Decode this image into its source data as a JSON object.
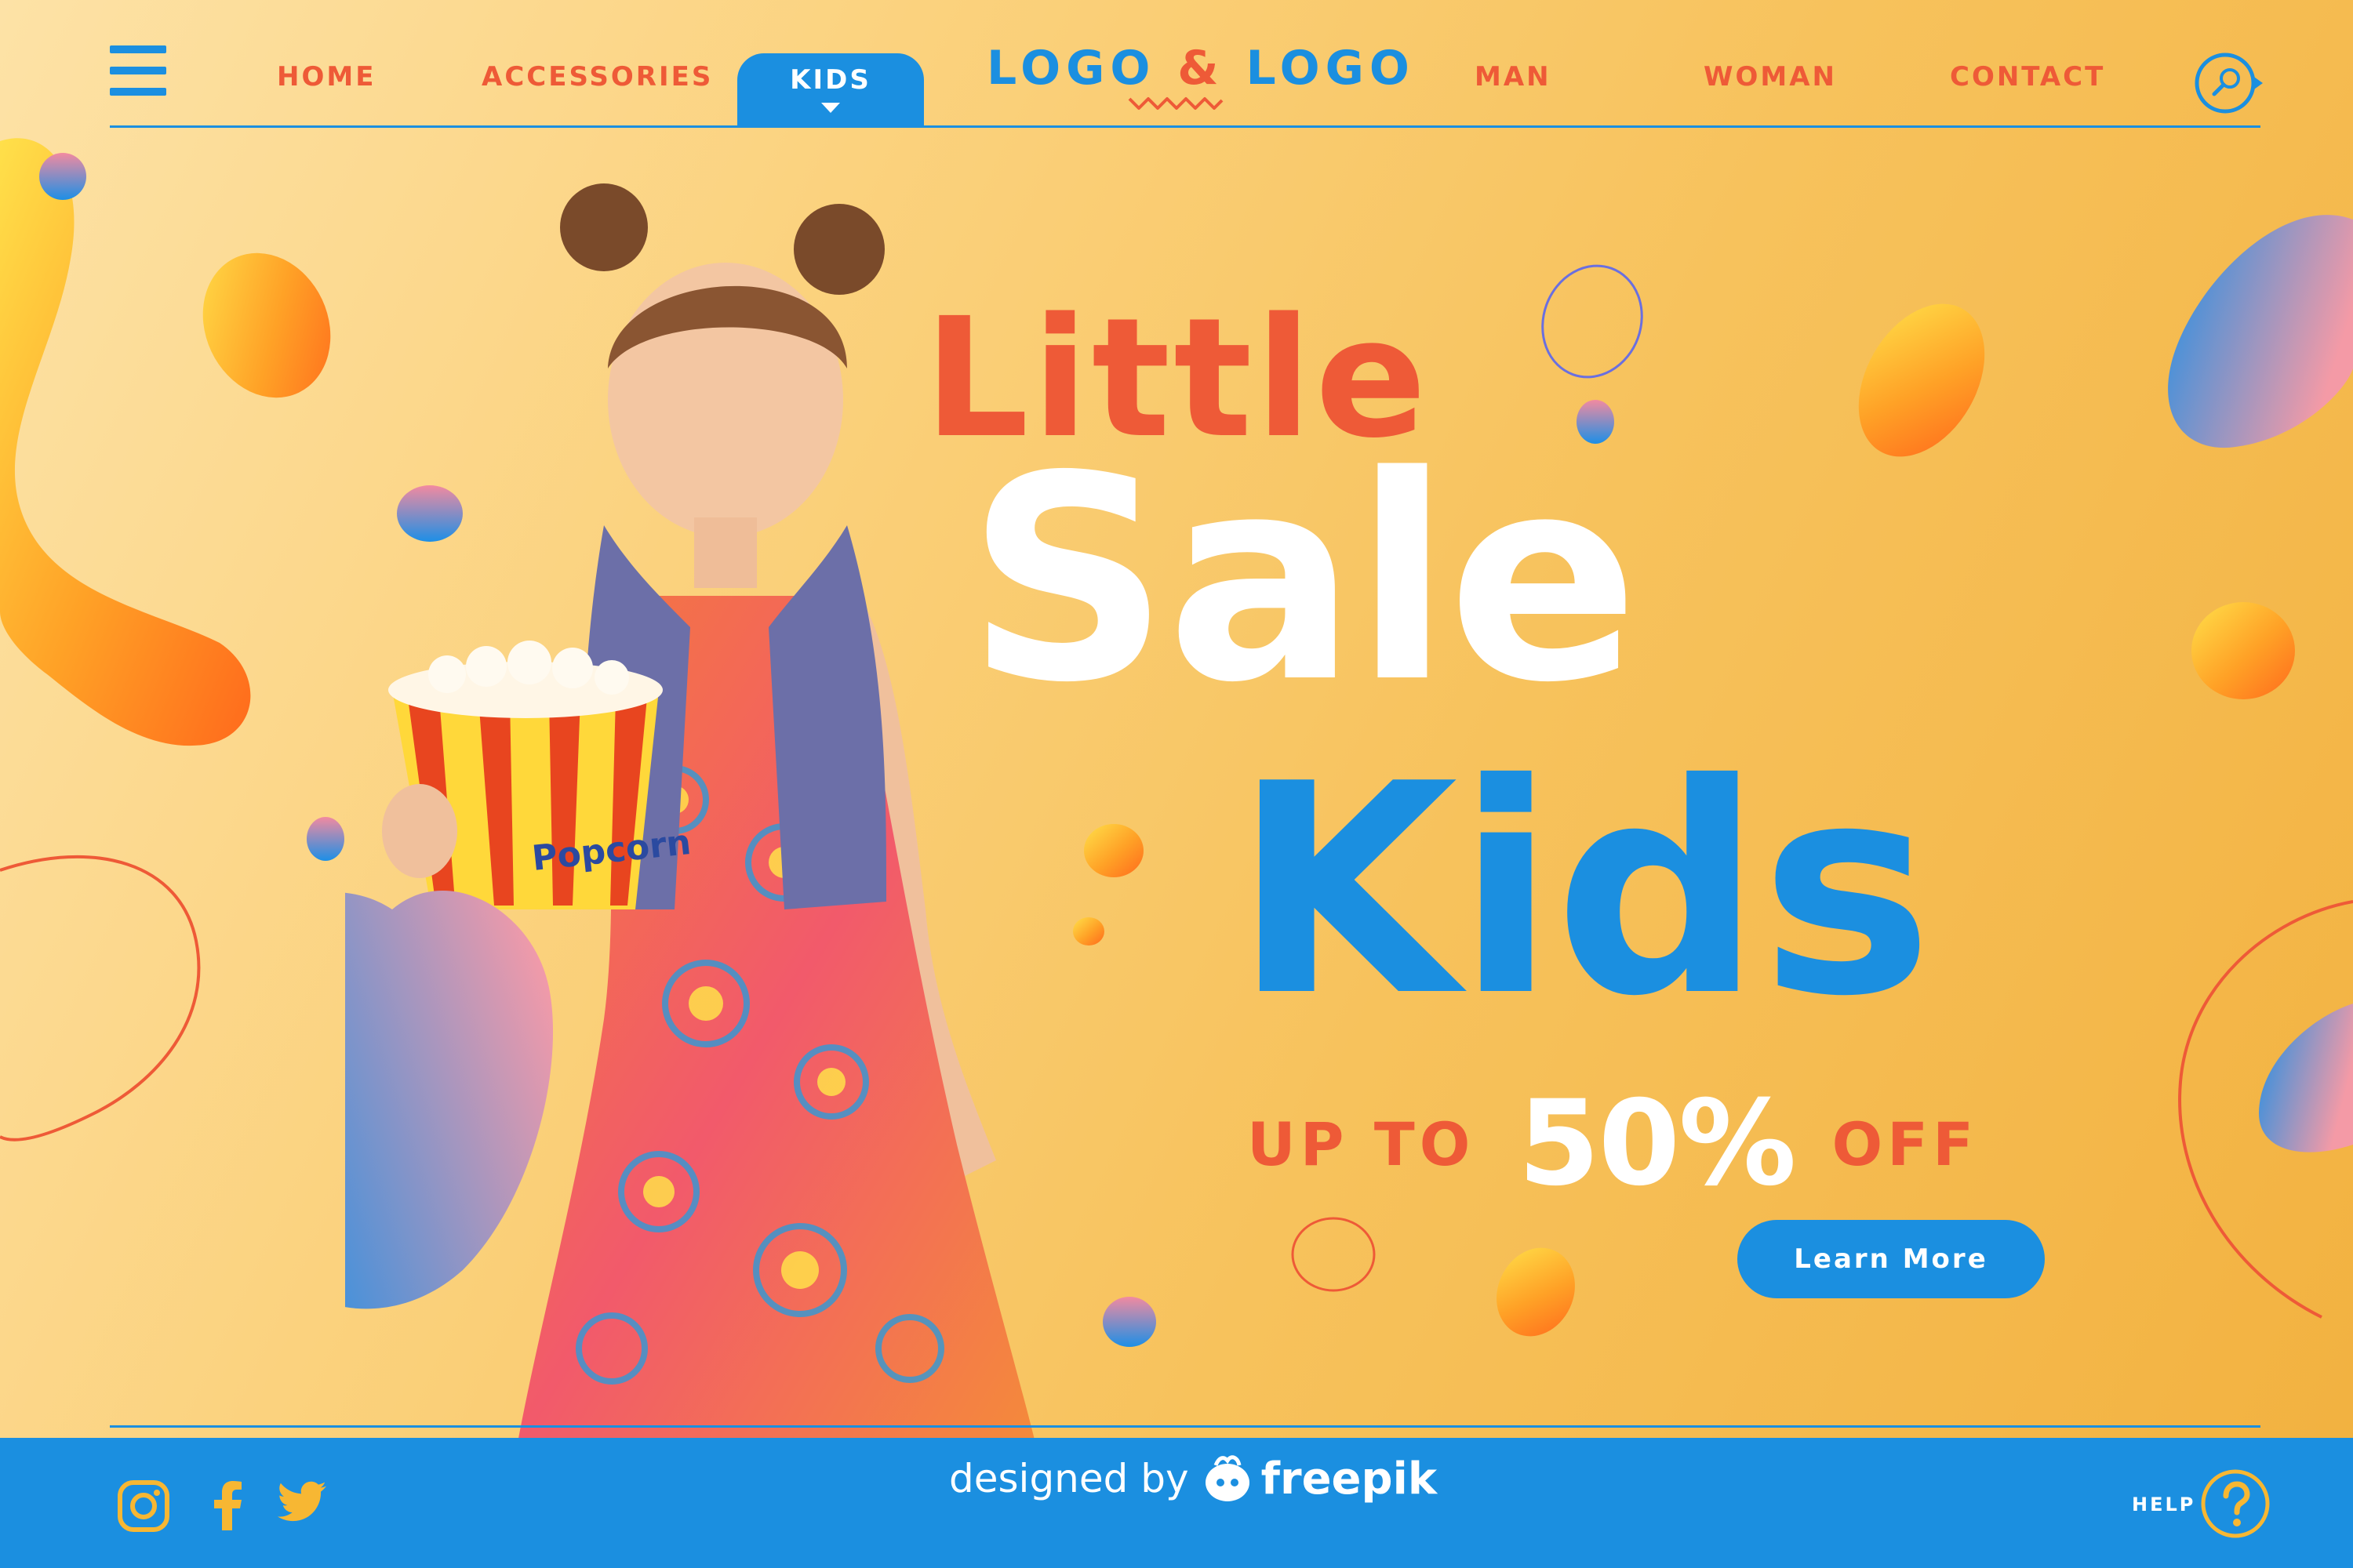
{
  "nav": {
    "menu_icon": "hamburger-icon",
    "links": [
      {
        "label": "HOME"
      },
      {
        "label": "ACCESSORIES"
      },
      {
        "label": "KIDS",
        "active": true
      },
      {
        "label": "MAN"
      },
      {
        "label": "WOMAN"
      },
      {
        "label": "CONTACT"
      }
    ],
    "logo": {
      "left": "LOGO",
      "amp": "&",
      "right": "LOGO"
    },
    "search_icon": "search-icon"
  },
  "hero": {
    "line1": "Little",
    "line2": "Sale",
    "line3": "Kids",
    "promo_pre": "UP TO",
    "promo_value": "50%",
    "promo_post": "OFF",
    "cta_label": "Learn More",
    "photo_text": "Popcorn"
  },
  "footer": {
    "social_icons": [
      "instagram-icon",
      "facebook-icon",
      "twitter-icon"
    ],
    "credit_prefix": "designed by",
    "credit_brand": "freepik",
    "help_label": "HELP",
    "help_icon": "question-icon"
  },
  "colors": {
    "accent_blue": "#1b8fe0",
    "accent_orange": "#ee5a37",
    "background_top": "#fde2a6",
    "background_bottom": "#f2b13f",
    "white": "#ffffff"
  }
}
